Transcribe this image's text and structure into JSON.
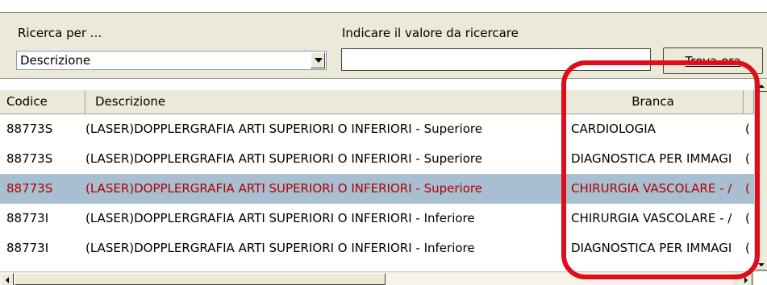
{
  "search": {
    "search_by_label": "Ricerca per ...",
    "search_by_value": "Descrizione",
    "value_label": "Indicare il valore da ricercare",
    "value_input": "",
    "find_button_label": "Trova ora"
  },
  "grid": {
    "headers": {
      "code": "Codice",
      "description": "Descrizione",
      "branch": "Branca"
    },
    "rows": [
      {
        "code": "88773S",
        "description": "(LASER)DOPPLERGRAFIA  ARTI SUPERIORI O INFERIORI  - Superiore",
        "branch": "CARDIOLOGIA",
        "extra": "("
      },
      {
        "code": "88773S",
        "description": "(LASER)DOPPLERGRAFIA  ARTI SUPERIORI O INFERIORI  - Superiore",
        "branch": "DIAGNOSTICA PER IMMAGI",
        "extra": "("
      },
      {
        "code": "88773S",
        "description": "(LASER)DOPPLERGRAFIA  ARTI SUPERIORI O INFERIORI  - Superiore",
        "branch": "CHIRURGIA VASCOLARE - /",
        "extra": "("
      },
      {
        "code": "88773I",
        "description": "(LASER)DOPPLERGRAFIA ARTI SUPERIORI O INFERIORI  - Inferiore",
        "branch": "CHIRURGIA VASCOLARE - /",
        "extra": "("
      },
      {
        "code": "88773I",
        "description": "(LASER)DOPPLERGRAFIA ARTI SUPERIORI O INFERIORI  - Inferiore",
        "branch": "DIAGNOSTICA PER IMMAGI",
        "extra": "("
      }
    ],
    "selected_row_index": 2
  },
  "colors": {
    "panel": "#ece9d8",
    "selection": "#a7bfd0",
    "selection_text": "#b00000",
    "annotation": "#e10c1a"
  },
  "icons": {
    "dropdown": "chevron-down-icon",
    "scroll_up": "arrow-up-icon",
    "scroll_down": "arrow-down-icon",
    "scroll_left": "arrow-left-icon",
    "scroll_right": "arrow-right-icon"
  }
}
